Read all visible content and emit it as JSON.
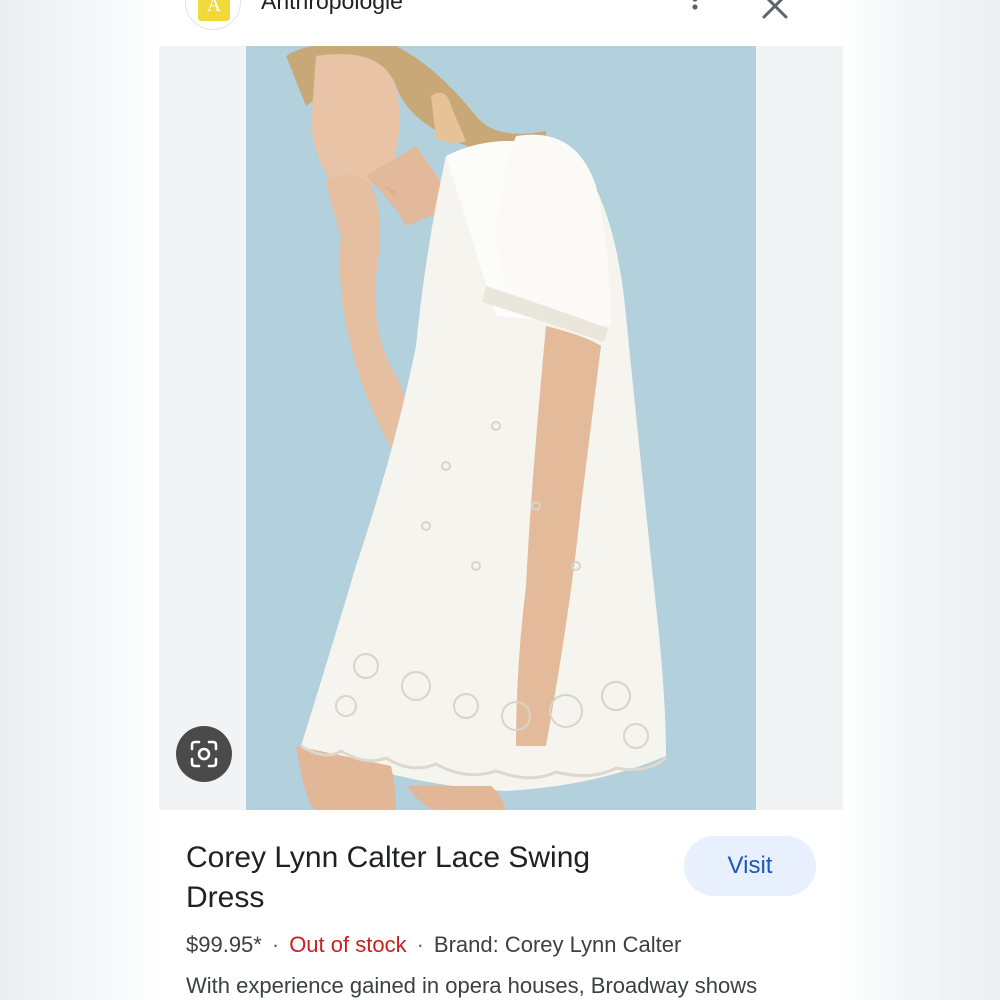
{
  "header": {
    "site_initial": "A",
    "site_name": "Anthropologie"
  },
  "colors": {
    "accent": "#1a56c4",
    "visit_bg": "#e8f0fe",
    "out_of_stock": "#c5221f",
    "image_background": "#b9d5e0"
  },
  "product": {
    "title": "Corey Lynn Calter Lace Swing Dress",
    "price": "$99.95*",
    "stock_status": "Out of stock",
    "brand": "Brand: Corey Lynn Calter",
    "description": "With experience gained in opera houses, Broadway shows",
    "separator": "·"
  },
  "actions": {
    "visit_label": "Visit"
  },
  "icons": {
    "more": "more-vert-icon",
    "close": "close-icon",
    "lens": "lens-search-icon"
  }
}
